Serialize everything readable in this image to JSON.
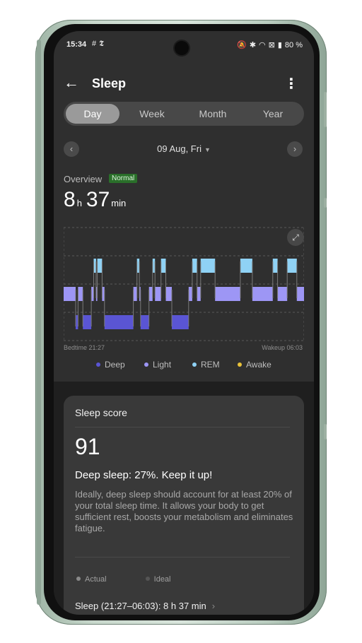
{
  "status": {
    "time": "15:34",
    "left_icons": [
      "grid-icon",
      "news-icon"
    ],
    "right_icons": [
      "mute-icon",
      "bluetooth-icon",
      "wifi-icon",
      "close-box-icon",
      "battery-icon"
    ],
    "battery": "80 %"
  },
  "appbar": {
    "title": "Sleep"
  },
  "tabs": [
    {
      "label": "Day",
      "active": true
    },
    {
      "label": "Week",
      "active": false
    },
    {
      "label": "Month",
      "active": false
    },
    {
      "label": "Year",
      "active": false
    }
  ],
  "date": {
    "label": "09 Aug, Fri"
  },
  "overview": {
    "label": "Overview",
    "badge": "Normal",
    "hours": "8",
    "hours_unit": "h",
    "minutes": "37",
    "minutes_unit": "min"
  },
  "chart_data": {
    "type": "bar",
    "x_start": "21:27",
    "x_end": "06:03",
    "start_label": "Bedtime 21:27",
    "end_label": "Wakeup 06:03",
    "stages": [
      "Awake",
      "REM",
      "Light",
      "Deep"
    ],
    "series": [
      {
        "name": "Deep",
        "color": "#5a55d4"
      },
      {
        "name": "Light",
        "color": "#9d96f5"
      },
      {
        "name": "REM",
        "color": "#8fd2f5"
      },
      {
        "name": "Awake",
        "color": "#e9c23a"
      }
    ],
    "segments": [
      {
        "stage": "Light",
        "start": 0.0,
        "end": 0.05
      },
      {
        "stage": "Deep",
        "start": 0.05,
        "end": 0.06
      },
      {
        "stage": "Light",
        "start": 0.06,
        "end": 0.08
      },
      {
        "stage": "Deep",
        "start": 0.08,
        "end": 0.115
      },
      {
        "stage": "Light",
        "start": 0.115,
        "end": 0.125
      },
      {
        "stage": "REM",
        "start": 0.125,
        "end": 0.135
      },
      {
        "stage": "Light",
        "start": 0.135,
        "end": 0.14
      },
      {
        "stage": "REM",
        "start": 0.14,
        "end": 0.16
      },
      {
        "stage": "Light",
        "start": 0.16,
        "end": 0.17
      },
      {
        "stage": "Deep",
        "start": 0.17,
        "end": 0.29
      },
      {
        "stage": "Light",
        "start": 0.29,
        "end": 0.305
      },
      {
        "stage": "REM",
        "start": 0.305,
        "end": 0.315
      },
      {
        "stage": "Light",
        "start": 0.315,
        "end": 0.32
      },
      {
        "stage": "Deep",
        "start": 0.32,
        "end": 0.355
      },
      {
        "stage": "Light",
        "start": 0.355,
        "end": 0.37
      },
      {
        "stage": "REM",
        "start": 0.37,
        "end": 0.38
      },
      {
        "stage": "Light",
        "start": 0.38,
        "end": 0.405
      },
      {
        "stage": "REM",
        "start": 0.405,
        "end": 0.425
      },
      {
        "stage": "Light",
        "start": 0.425,
        "end": 0.45
      },
      {
        "stage": "Deep",
        "start": 0.45,
        "end": 0.52
      },
      {
        "stage": "Light",
        "start": 0.52,
        "end": 0.535
      },
      {
        "stage": "REM",
        "start": 0.535,
        "end": 0.555
      },
      {
        "stage": "Light",
        "start": 0.555,
        "end": 0.57
      },
      {
        "stage": "REM",
        "start": 0.57,
        "end": 0.63
      },
      {
        "stage": "Light",
        "start": 0.63,
        "end": 0.735
      },
      {
        "stage": "REM",
        "start": 0.735,
        "end": 0.785
      },
      {
        "stage": "Light",
        "start": 0.785,
        "end": 0.87
      },
      {
        "stage": "REM",
        "start": 0.87,
        "end": 0.89
      },
      {
        "stage": "Light",
        "start": 0.89,
        "end": 0.93
      },
      {
        "stage": "REM",
        "start": 0.93,
        "end": 0.97
      },
      {
        "stage": "Light",
        "start": 0.97,
        "end": 1.0
      }
    ]
  },
  "chart": {
    "expand_icon": "expand-icon"
  },
  "legend": [
    {
      "label": "Deep",
      "color": "#5a55d4"
    },
    {
      "label": "Light",
      "color": "#9d96f5"
    },
    {
      "label": "REM",
      "color": "#8fd2f5"
    },
    {
      "label": "Awake",
      "color": "#e9c23a"
    }
  ],
  "score_card": {
    "title": "Sleep score",
    "score": "91",
    "headline": "Deep sleep: 27%. Keep it up!",
    "description": "Ideally, deep sleep should account for at least 20% of your total sleep time. It allows your body to get sufficient rest, boosts your metabolism and eliminates fatigue.",
    "legend_actual": "Actual",
    "legend_ideal": "Ideal",
    "sleep_summary": "Sleep (21:27–06:03): 8 h 37 min"
  }
}
